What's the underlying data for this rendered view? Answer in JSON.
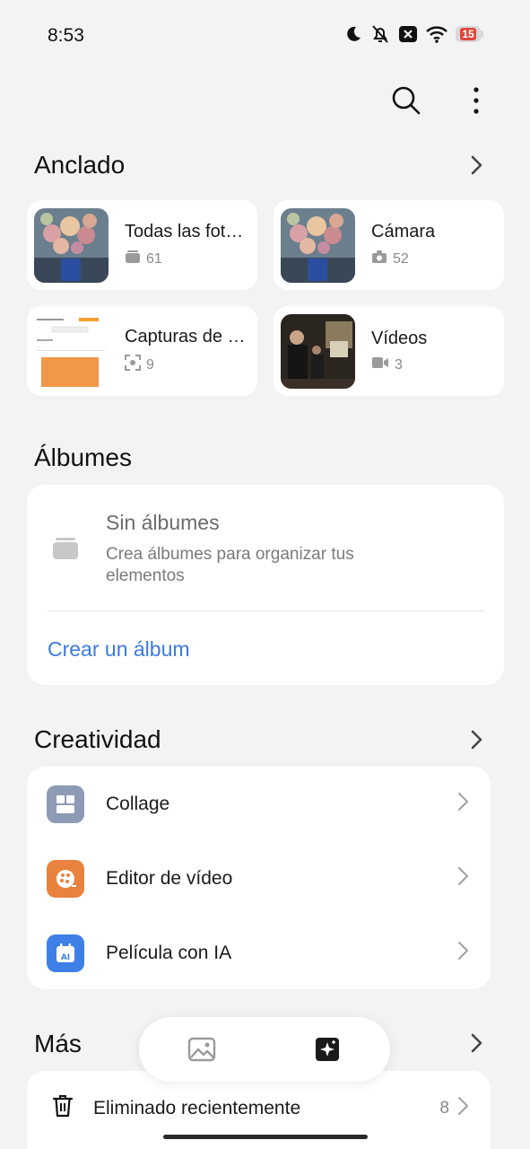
{
  "status_bar": {
    "time": "8:53",
    "battery_level": "15",
    "icons": [
      "moon-icon",
      "bell-off-icon",
      "x-box-icon",
      "wifi-icon",
      "battery-icon"
    ]
  },
  "toolbar": {
    "icons": [
      "search-icon",
      "more-vert-icon"
    ]
  },
  "pinned": {
    "title": "Anclado",
    "items": [
      {
        "title": "Todas las fot…",
        "count": "61",
        "icon": "album-stack-icon"
      },
      {
        "title": "Cámara",
        "count": "52",
        "icon": "camera-icon"
      },
      {
        "title": "Capturas de …",
        "count": "9",
        "icon": "screenshot-icon"
      },
      {
        "title": "Vídeos",
        "count": "3",
        "icon": "video-icon"
      }
    ]
  },
  "albums": {
    "title": "Álbumes",
    "empty_title": "Sin álbumes",
    "empty_subtitle": "Crea álbumes para organizar tus elementos",
    "create_label": "Crear un álbum"
  },
  "creativity": {
    "title": "Creatividad",
    "items": [
      {
        "label": "Collage",
        "icon": "collage-icon",
        "color": "#8d9bb5"
      },
      {
        "label": "Editor de vídeo",
        "icon": "video-editor-icon",
        "color": "#e9813f"
      },
      {
        "label": "Película con IA",
        "icon": "ai-movie-icon",
        "color": "#3f7fe8"
      }
    ]
  },
  "more": {
    "title": "Más",
    "items": [
      {
        "label": "Eliminado recientemente",
        "count": "8",
        "icon": "trash-icon"
      }
    ]
  },
  "bottom_nav": {
    "items": [
      "photos-tab-icon",
      "creativity-tab-icon"
    ]
  },
  "colors": {
    "accent": "#3a7be0",
    "background": "#f3f3f3",
    "card": "#ffffff",
    "battery_low": "#e2453c"
  }
}
